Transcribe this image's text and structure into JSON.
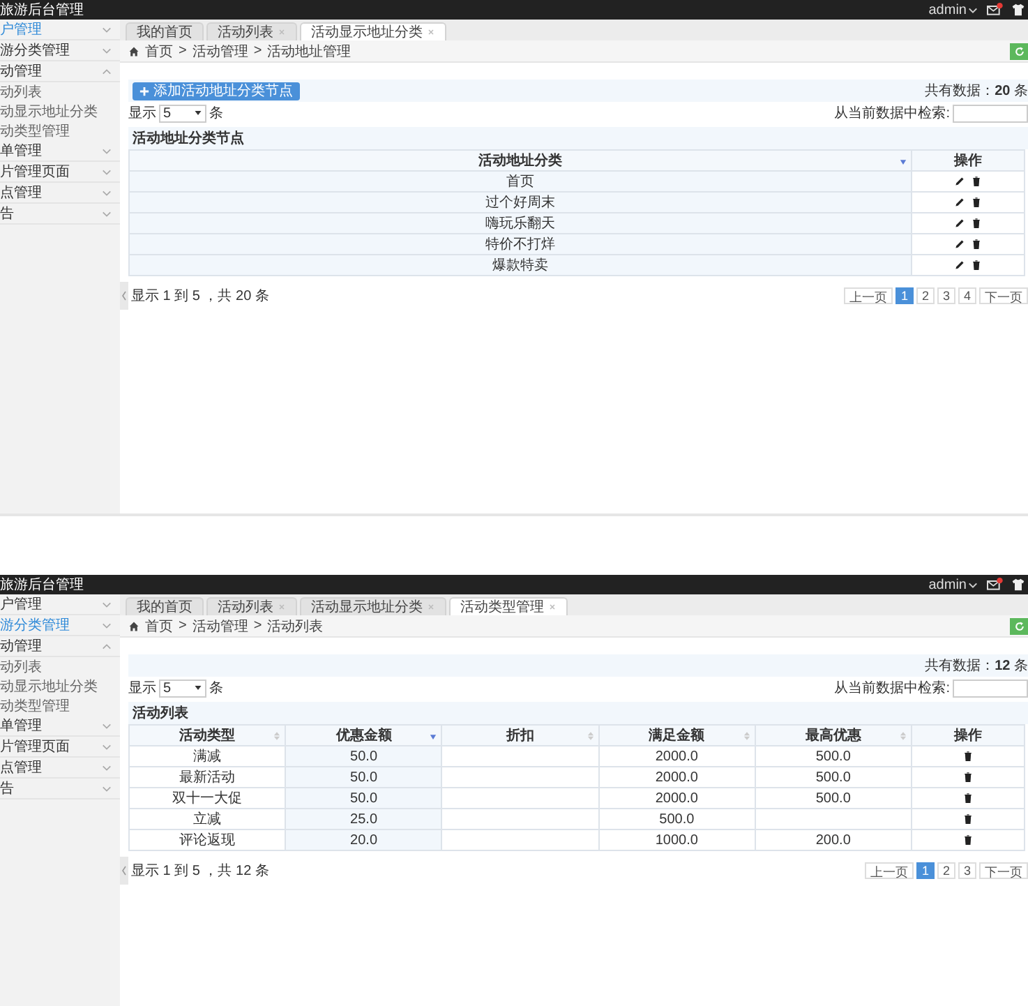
{
  "screens": [
    {
      "header": {
        "title": "旅游后台管理",
        "user": "admin"
      },
      "sidebar": {
        "items": [
          {
            "label": "户管理",
            "selected": true,
            "expanded": false
          },
          {
            "label": "游分类管理",
            "selected": false,
            "expanded": false
          },
          {
            "label": "动管理",
            "selected": false,
            "expanded": true,
            "children": [
              {
                "label": "动列表",
                "selected": false
              },
              {
                "label": "动显示地址分类",
                "selected": false
              },
              {
                "label": "动类型管理",
                "selected": false
              }
            ]
          },
          {
            "label": "单管理",
            "selected": false,
            "expanded": false
          },
          {
            "label": "片管理页面",
            "selected": false,
            "expanded": false
          },
          {
            "label": "点管理",
            "selected": false,
            "expanded": false
          },
          {
            "label": "告",
            "selected": false,
            "expanded": false
          }
        ]
      },
      "tabs": [
        {
          "label": "我的首页",
          "selected": false,
          "closable": false
        },
        {
          "label": "活动列表",
          "selected": false,
          "closable": true
        },
        {
          "label": "活动显示地址分类",
          "selected": true,
          "closable": true
        }
      ],
      "breadcrumb": [
        "首页",
        ">",
        "活动管理",
        ">",
        "活动地址管理"
      ],
      "add_button": "添加活动地址分类节点",
      "total": "共有数据：**20** 条",
      "page_size": {
        "label": "显示",
        "value": "5",
        "unit": "条"
      },
      "search": {
        "label": "从当前数据中检索:"
      },
      "table": {
        "caption": "活动地址分类节点",
        "columns": [
          {
            "label": "活动地址分类",
            "sortable": true,
            "sorted": true,
            "kind": "text"
          },
          {
            "label": "操作",
            "sortable": false,
            "kind": "actions"
          }
        ],
        "rows": [
          {
            "cells": [
              "首页"
            ],
            "edit": true,
            "delete": true
          },
          {
            "cells": [
              "过个好周末"
            ],
            "edit": true,
            "delete": true
          },
          {
            "cells": [
              "嗨玩乐翻天"
            ],
            "edit": true,
            "delete": true
          },
          {
            "cells": [
              "特价不打烊"
            ],
            "edit": true,
            "delete": true
          },
          {
            "cells": [
              "爆款特卖"
            ],
            "edit": true,
            "delete": true
          }
        ]
      },
      "info": "显示 1 到 5 ，共 20 条",
      "pagination": [
        {
          "label": "上一页",
          "selected": false
        },
        {
          "label": "1",
          "selected": true
        },
        {
          "label": "2",
          "selected": false
        },
        {
          "label": "3",
          "selected": false
        },
        {
          "label": "4",
          "selected": false
        },
        {
          "label": "下一页",
          "selected": false
        }
      ]
    },
    {
      "header": {
        "title": "旅游后台管理",
        "user": "admin"
      },
      "sidebar": {
        "items": [
          {
            "label": "户管理",
            "selected": false,
            "expanded": false
          },
          {
            "label": "游分类管理",
            "selected": true,
            "expanded": false
          },
          {
            "label": "动管理",
            "selected": false,
            "expanded": true,
            "children": [
              {
                "label": "动列表",
                "selected": false
              },
              {
                "label": "动显示地址分类",
                "selected": false
              },
              {
                "label": "动类型管理",
                "selected": false
              }
            ]
          },
          {
            "label": "单管理",
            "selected": false,
            "expanded": false
          },
          {
            "label": "片管理页面",
            "selected": false,
            "expanded": false
          },
          {
            "label": "点管理",
            "selected": false,
            "expanded": false
          },
          {
            "label": "告",
            "selected": false,
            "expanded": false
          }
        ]
      },
      "tabs": [
        {
          "label": "我的首页",
          "selected": false,
          "closable": false
        },
        {
          "label": "活动列表",
          "selected": false,
          "closable": true
        },
        {
          "label": "活动显示地址分类",
          "selected": false,
          "closable": true
        },
        {
          "label": "活动类型管理",
          "selected": true,
          "closable": true
        }
      ],
      "breadcrumb": [
        "首页",
        ">",
        "活动管理",
        ">",
        "活动列表"
      ],
      "total": "共有数据：**12** 条",
      "page_size": {
        "label": "显示",
        "value": "5",
        "unit": "条"
      },
      "search": {
        "label": "从当前数据中检索:"
      },
      "table": {
        "caption": "活动列表",
        "columns": [
          {
            "label": "活动类型",
            "sortable": true,
            "sorted": false,
            "kind": "text"
          },
          {
            "label": "优惠金额",
            "sortable": true,
            "sorted": true,
            "kind": "text"
          },
          {
            "label": "折扣",
            "sortable": true,
            "sorted": false,
            "kind": "text"
          },
          {
            "label": "满足金额",
            "sortable": true,
            "sorted": false,
            "kind": "text"
          },
          {
            "label": "最高优惠",
            "sortable": true,
            "sorted": false,
            "kind": "text"
          },
          {
            "label": "操作",
            "sortable": false,
            "kind": "actions"
          }
        ],
        "rows": [
          {
            "cells": [
              "满减",
              "50.0",
              "",
              "2000.0",
              "500.0"
            ],
            "edit": false,
            "delete": true
          },
          {
            "cells": [
              "最新活动",
              "50.0",
              "",
              "2000.0",
              "500.0"
            ],
            "edit": false,
            "delete": true
          },
          {
            "cells": [
              "双十一大促",
              "50.0",
              "",
              "2000.0",
              "500.0"
            ],
            "edit": false,
            "delete": true
          },
          {
            "cells": [
              "立减",
              "25.0",
              "",
              "500.0",
              ""
            ],
            "edit": false,
            "delete": true
          },
          {
            "cells": [
              "评论返现",
              "20.0",
              "",
              "1000.0",
              "200.0"
            ],
            "edit": false,
            "delete": true
          }
        ]
      },
      "info": "显示 1 到 5 ，共 12 条",
      "pagination": [
        {
          "label": "上一页",
          "selected": false
        },
        {
          "label": "1",
          "selected": true
        },
        {
          "label": "2",
          "selected": false
        },
        {
          "label": "3",
          "selected": false
        },
        {
          "label": "下一页",
          "selected": false
        }
      ]
    }
  ]
}
